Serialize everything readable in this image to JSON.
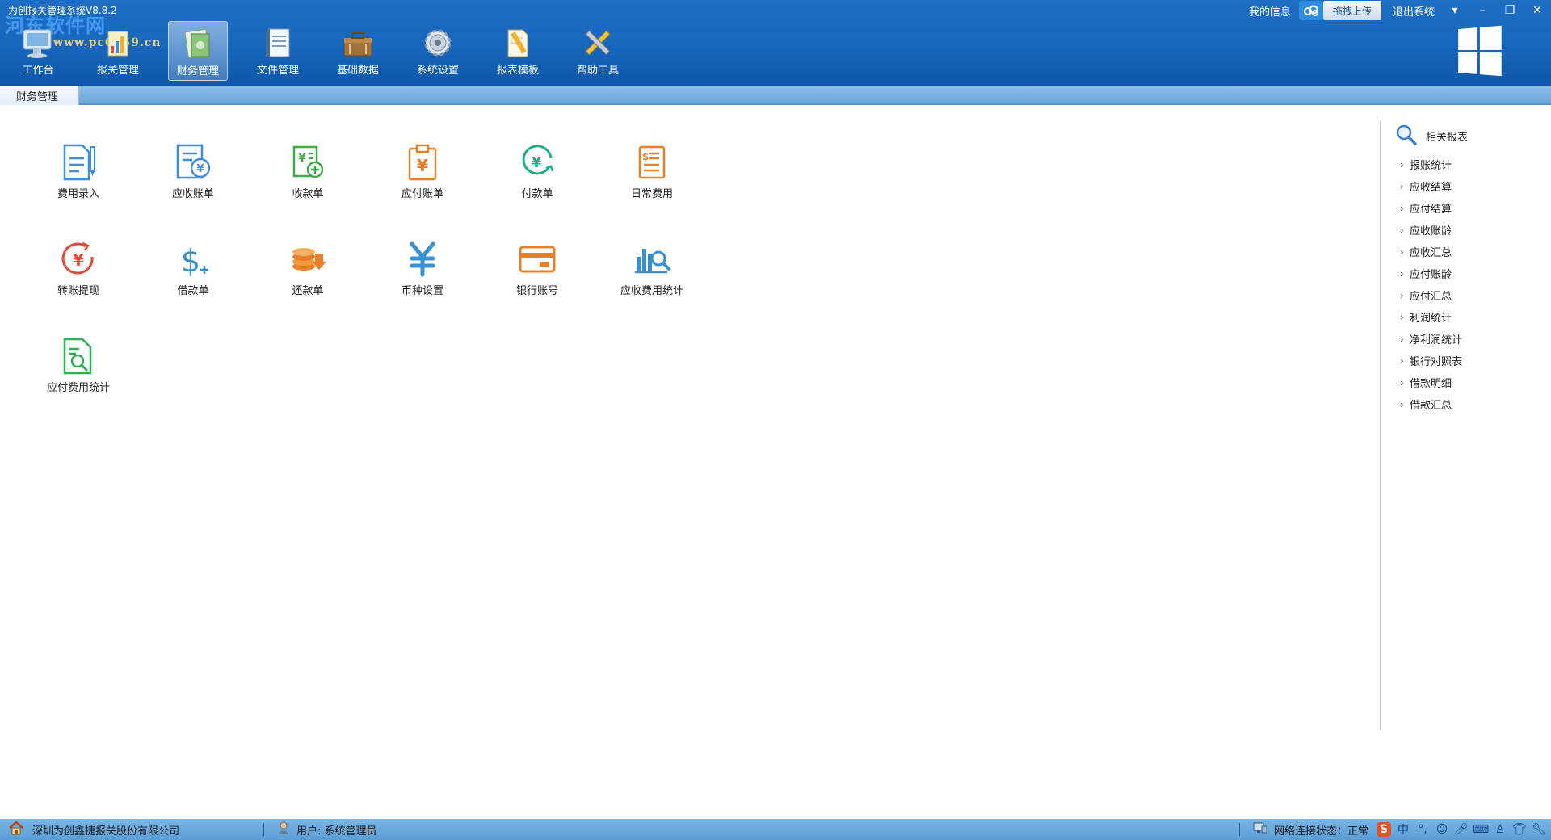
{
  "app": {
    "title": "为创报关管理系统V8.8.2",
    "watermark": "河东软件网",
    "watermark_url": "www.pc0359.cn"
  },
  "header_links": {
    "my_info": "我的信息",
    "upload": "拖拽上传",
    "logout": "退出系统"
  },
  "nav": [
    {
      "label": "工作台",
      "icon": "workbench-icon"
    },
    {
      "label": "报关管理",
      "icon": "customs-icon"
    },
    {
      "label": "财务管理",
      "icon": "finance-icon",
      "active": true
    },
    {
      "label": "文件管理",
      "icon": "notebook-icon"
    },
    {
      "label": "基础数据",
      "icon": "toolbox-icon"
    },
    {
      "label": "系统设置",
      "icon": "gear-icon"
    },
    {
      "label": "报表模板",
      "icon": "pencil-doc-icon"
    },
    {
      "label": "帮助工具",
      "icon": "tools-icon"
    }
  ],
  "tab": {
    "label": "财务管理"
  },
  "functions": [
    {
      "label": "费用录入",
      "icon": "expense-entry-icon",
      "color": "#3d8ee0"
    },
    {
      "label": "应收账单",
      "icon": "receivable-bill-icon",
      "color": "#3d8ee0"
    },
    {
      "label": "收款单",
      "icon": "receipt-icon",
      "color": "#44a84a"
    },
    {
      "label": "应付账单",
      "icon": "payable-bill-icon",
      "color": "#e8802a"
    },
    {
      "label": "付款单",
      "icon": "payment-icon",
      "color": "#1fae8a"
    },
    {
      "label": "日常费用",
      "icon": "daily-expense-icon",
      "color": "#e8802a"
    },
    {
      "label": "转账提现",
      "icon": "transfer-icon",
      "color": "#e04a3a"
    },
    {
      "label": "借款单",
      "icon": "loan-icon",
      "color": "#3a8fc8"
    },
    {
      "label": "还款单",
      "icon": "repayment-icon",
      "color": "#e8802a"
    },
    {
      "label": "币种设置",
      "icon": "currency-icon",
      "color": "#3a8fd0"
    },
    {
      "label": "银行账号",
      "icon": "bank-card-icon",
      "color": "#e8802a"
    },
    {
      "label": "应收费用统计",
      "icon": "receivable-stats-icon",
      "color": "#3a8fd0"
    },
    {
      "label": "应付费用统计",
      "icon": "payable-stats-icon",
      "color": "#2fae55"
    }
  ],
  "related_reports": {
    "title": "相关报表",
    "items": [
      "报账统计",
      "应收结算",
      "应付结算",
      "应收账龄",
      "应收汇总",
      "应付账龄",
      "应付汇总",
      "利润统计",
      "净利润统计",
      "银行对照表",
      "借款明细",
      "借款汇总"
    ]
  },
  "status": {
    "company": "深圳为创鑫捷报关股份有限公司",
    "user": "用户: 系统管理员",
    "network": "网络连接状态：正常",
    "ime_label": "中"
  },
  "colors": {
    "header": "#1766bd",
    "tabstrip": "#7ab4e2",
    "statusbar": "#6aa8dc"
  }
}
